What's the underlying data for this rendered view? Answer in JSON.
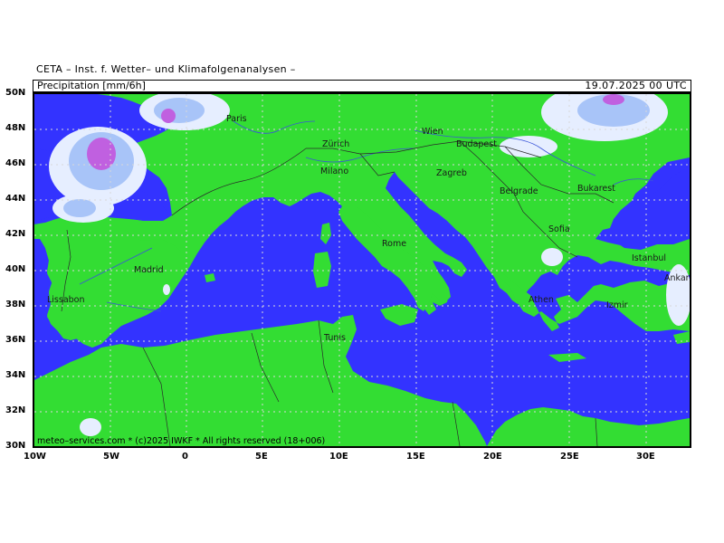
{
  "header": {
    "source": "CETA – Inst. f. Wetter– und Klimafolgenanalysen –",
    "product": "Precipitation [mm/6h]",
    "valid_time": "19.07.2025 00 UTC"
  },
  "footer": {
    "copyright": "meteo–services.com * (c)2025 IWKF * All rights reserved (18+006)"
  },
  "colors": {
    "sea": "#3333ff",
    "land": "#33dd33",
    "precip_light": "#e8f0ff",
    "precip_mid": "#a8c4f8",
    "precip_high": "#c060e0",
    "grid": "#c8c8c8",
    "border": "#2a2a2a",
    "river": "#3a55d8"
  },
  "lat_labels": [
    "50N",
    "48N",
    "46N",
    "44N",
    "42N",
    "40N",
    "38N",
    "36N",
    "34N",
    "32N",
    "30N"
  ],
  "lon_labels": [
    "10W",
    "5W",
    "0",
    "5E",
    "10E",
    "15E",
    "20E",
    "25E",
    "30E"
  ],
  "cities": [
    "Paris",
    "Wien",
    "Zürich",
    "Budapest",
    "Zagreb",
    "Belgrade",
    "Bukarest",
    "Milano",
    "Sofia",
    "Madrid",
    "Rome",
    "Istanbul",
    "Ankara",
    "Lissabon",
    "Athen",
    "Izmir",
    "Tunis"
  ]
}
